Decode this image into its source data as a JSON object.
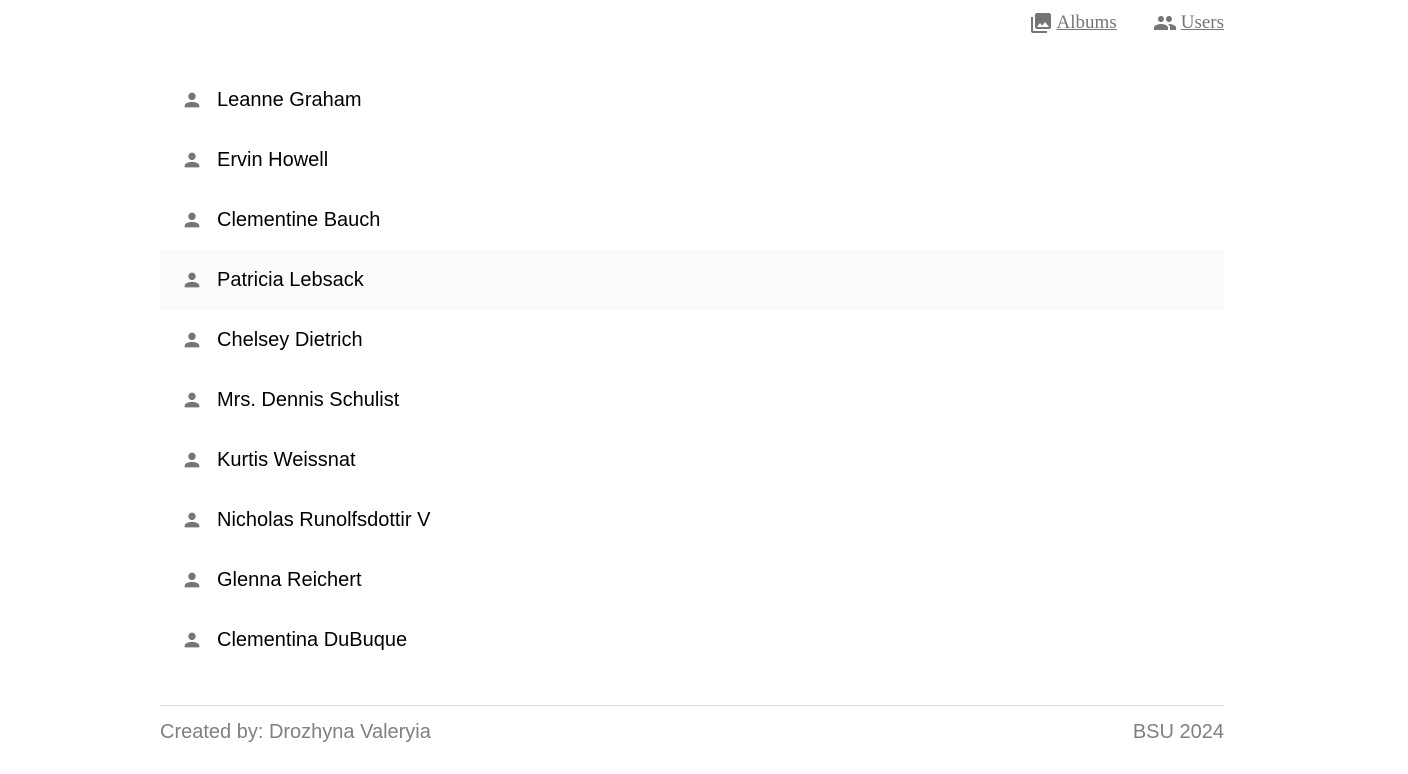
{
  "nav": {
    "albums": {
      "label": "Albums",
      "icon": "photo-library-icon"
    },
    "users": {
      "label": "Users",
      "icon": "people-icon"
    }
  },
  "users": [
    {
      "name": "Leanne Graham",
      "icon": "person-icon"
    },
    {
      "name": "Ervin Howell",
      "icon": "person-icon"
    },
    {
      "name": "Clementine Bauch",
      "icon": "person-icon"
    },
    {
      "name": "Patricia Lebsack",
      "icon": "person-icon",
      "hovered": true
    },
    {
      "name": "Chelsey Dietrich",
      "icon": "person-icon"
    },
    {
      "name": "Mrs. Dennis Schulist",
      "icon": "person-icon"
    },
    {
      "name": "Kurtis Weissnat",
      "icon": "person-icon"
    },
    {
      "name": "Nicholas Runolfsdottir V",
      "icon": "person-icon"
    },
    {
      "name": "Glenna Reichert",
      "icon": "person-icon"
    },
    {
      "name": "Clementina DuBuque",
      "icon": "person-icon"
    }
  ],
  "footer": {
    "credit": "Created by: Drozhyna Valeryia",
    "org": "BSU 2024"
  },
  "colors": {
    "icon": "#757575",
    "link": "#757575",
    "footer_text": "#808080",
    "hover_bg": "#fbfbfb"
  }
}
